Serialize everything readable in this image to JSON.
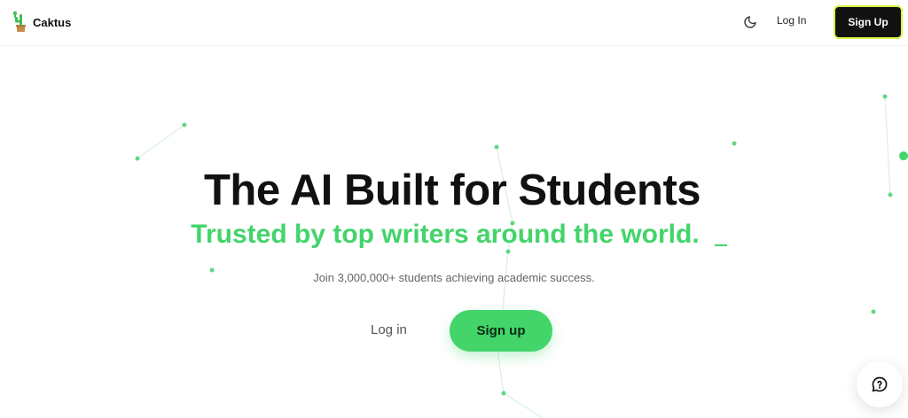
{
  "header": {
    "brand": "Caktus",
    "login_label": "Log In",
    "signup_label": "Sign Up"
  },
  "hero": {
    "title": "The AI Built for Students",
    "subtitle": "Trusted by top writers around the world.",
    "description": "Join 3,000,000+ students achieving academic success.",
    "login_label": "Log in",
    "signup_label": "Sign up"
  },
  "icons": {
    "theme_toggle": "moon-icon",
    "chat": "chat-bubble-help-icon",
    "logo": "cactus-logo-icon"
  },
  "colors": {
    "accent_green": "#43d46a",
    "signup_bg": "#111111",
    "signup_border": "#d4f542"
  }
}
